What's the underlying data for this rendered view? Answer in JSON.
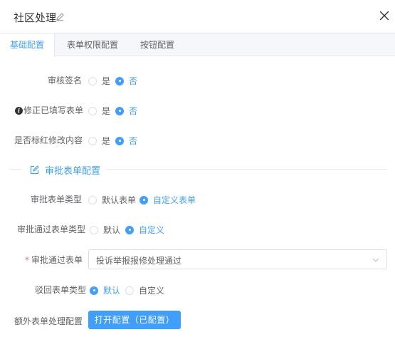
{
  "header": {
    "title": "社区处理"
  },
  "tabs": [
    {
      "label": "基础配置",
      "active": true
    },
    {
      "label": "表单权限配置",
      "active": false
    },
    {
      "label": "按钮配置",
      "active": false
    }
  ],
  "basic": {
    "review_signature": {
      "label": "审核签名",
      "options": [
        "是",
        "否"
      ],
      "selected": "否"
    },
    "modify_filled_form": {
      "label": "修正已填写表单",
      "options": [
        "是",
        "否"
      ],
      "selected": "否"
    },
    "mark_red_changes": {
      "label": "是否标红修改内容",
      "options": [
        "是",
        "否"
      ],
      "selected": "否"
    }
  },
  "approval_section": {
    "title": "审批表单配置",
    "form_type": {
      "label": "审批表单类型",
      "options": [
        "默认表单",
        "自定义表单"
      ],
      "selected": "自定义表单"
    },
    "pass_form_type": {
      "label": "审批通过表单类型",
      "options": [
        "默认",
        "自定义"
      ],
      "selected": "自定义"
    },
    "pass_form": {
      "label": "审批通过表单",
      "required_mark": "*",
      "value": "投诉举报报修处理通过"
    },
    "reject_form_type": {
      "label": "驳回表单类型",
      "options": [
        "默认",
        "自定义"
      ],
      "selected": "默认"
    },
    "extra_form": {
      "label": "额外表单处理配置",
      "button_label": "打开配置（已配置）"
    }
  },
  "colors": {
    "accent": "#409eff",
    "required": "#f56c6c",
    "tab_bar_bg": "#f5f7fa"
  }
}
